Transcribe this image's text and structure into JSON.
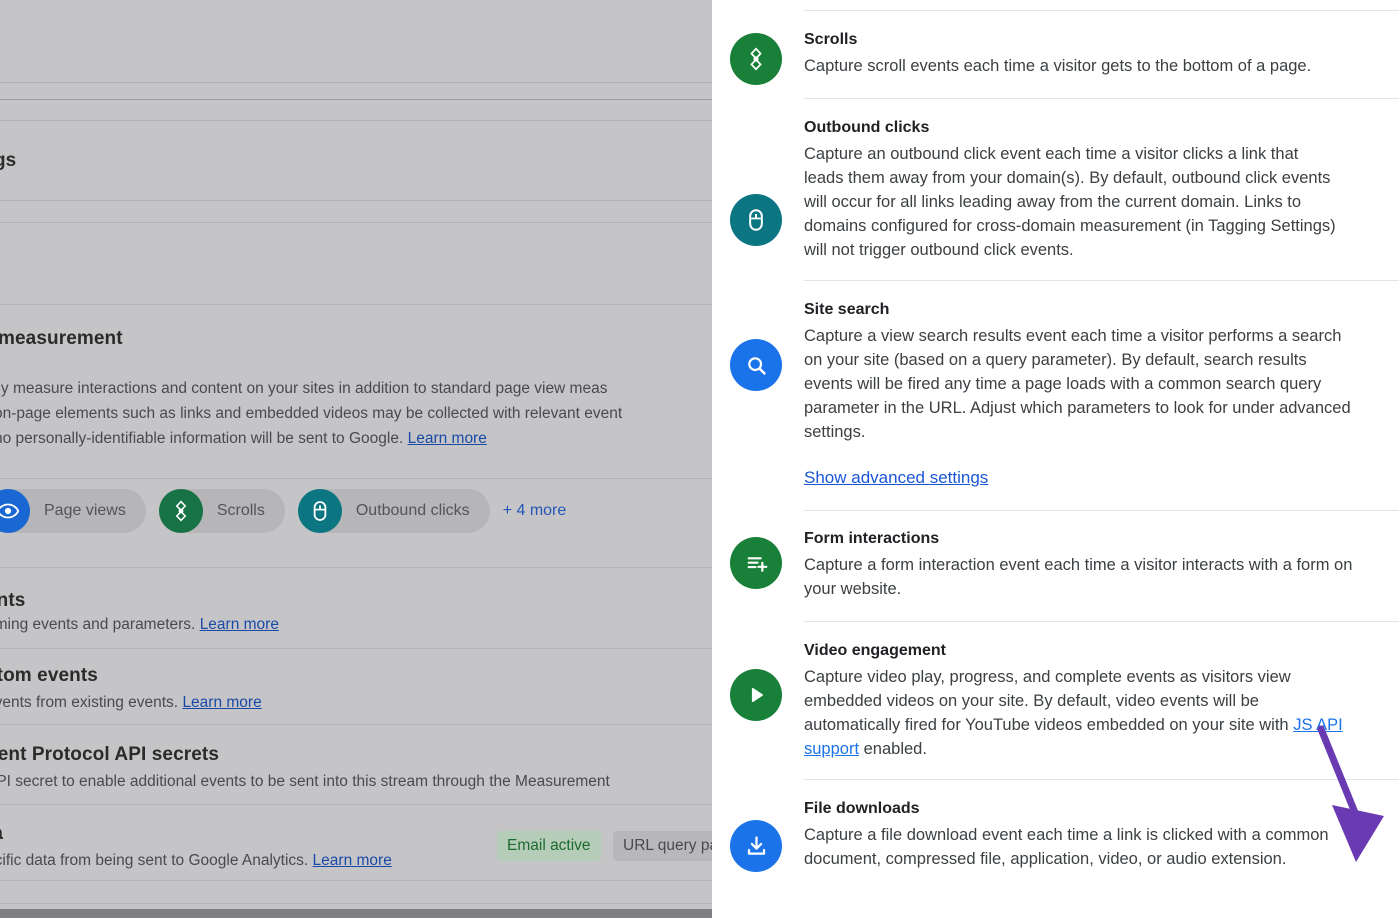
{
  "background": {
    "section_measurement": {
      "title": "measurement",
      "paragraph_line1": "lly measure interactions and content on your sites in addition to standard page view meas",
      "paragraph_line2": "on-page elements such as links and embedded videos may be collected with relevant event",
      "paragraph_line3": "no personally-identifiable information will be sent to Google.",
      "learn_more": "Learn more"
    },
    "chips": [
      {
        "label": "Page views",
        "icon": "eye-icon",
        "color": "#1967d2"
      },
      {
        "label": "Scrolls",
        "icon": "scroll-target-icon",
        "color": "#177245"
      },
      {
        "label": "Outbound clicks",
        "icon": "mouse-icon",
        "color": "#0b7581"
      }
    ],
    "chips_more": "+ 4 more",
    "section_events": {
      "title": "ents",
      "desc": "oming events and parameters.",
      "learn_more": "Learn more"
    },
    "section_custom_events": {
      "title": "stom events",
      "desc": "events from existing events.",
      "learn_more": "Learn more"
    },
    "section_mp_secrets": {
      "title": "nent Protocol API secrets",
      "desc": "API secret to enable additional events to be sent into this stream through the Measurement"
    },
    "section_data": {
      "title": "ta",
      "desc": "ecific data from being sent to Google Analytics.",
      "learn_more": "Learn more",
      "badge_active": "Email active",
      "badge_query": "URL query pa"
    },
    "partial_title_top": "gs"
  },
  "panel": {
    "rows": [
      {
        "id": "scrolls",
        "title": "Scrolls",
        "description": "Capture scroll events each time a visitor gets to the bottom of a page.",
        "icon": "scroll-target-icon",
        "icon_color": "#188038",
        "toggle_on": true
      },
      {
        "id": "outbound-clicks",
        "title": "Outbound clicks",
        "description": "Capture an outbound click event each time a visitor clicks a link that leads them away from your domain(s). By default, outbound click events will occur for all links leading away from the current domain. Links to domains configured for cross-domain measurement (in Tagging Settings) will not trigger outbound click events.",
        "icon": "mouse-icon",
        "icon_color": "#0b7581",
        "toggle_on": true
      },
      {
        "id": "site-search",
        "title": "Site search",
        "description": "Capture a view search results event each time a visitor performs a search on your site (based on a query parameter). By default, search results events will be fired any time a page loads with a common search query parameter in the URL. Adjust which parameters to look for under advanced settings.",
        "icon": "search-icon",
        "icon_color": "#1a73e8",
        "toggle_on": true,
        "advanced_link": "Show advanced settings"
      },
      {
        "id": "form-interactions",
        "title": "Form interactions",
        "description": "Capture a form interaction event each time a visitor interacts with a form on your website.",
        "icon": "form-plus-icon",
        "icon_color": "#188038",
        "toggle_on": true
      },
      {
        "id": "video-engagement",
        "title": "Video engagement",
        "description_before": "Capture video play, progress, and complete events as visitors view embedded videos on your site. By default, video events will be automatically fired for YouTube videos embedded on your site with ",
        "link_text": "JS API support",
        "description_after": " enabled.",
        "icon": "play-icon",
        "icon_color": "#188038",
        "toggle_on": true
      },
      {
        "id": "file-downloads",
        "title": "File downloads",
        "description": "Capture a file download event each time a link is clicked with a common document, compressed file, application, video, or audio extension.",
        "icon": "download-icon",
        "icon_color": "#1a73e8",
        "toggle_on": true
      }
    ]
  },
  "annotation": {
    "arrow_color": "#6a3ab2",
    "points_to": "file-downloads-toggle"
  }
}
